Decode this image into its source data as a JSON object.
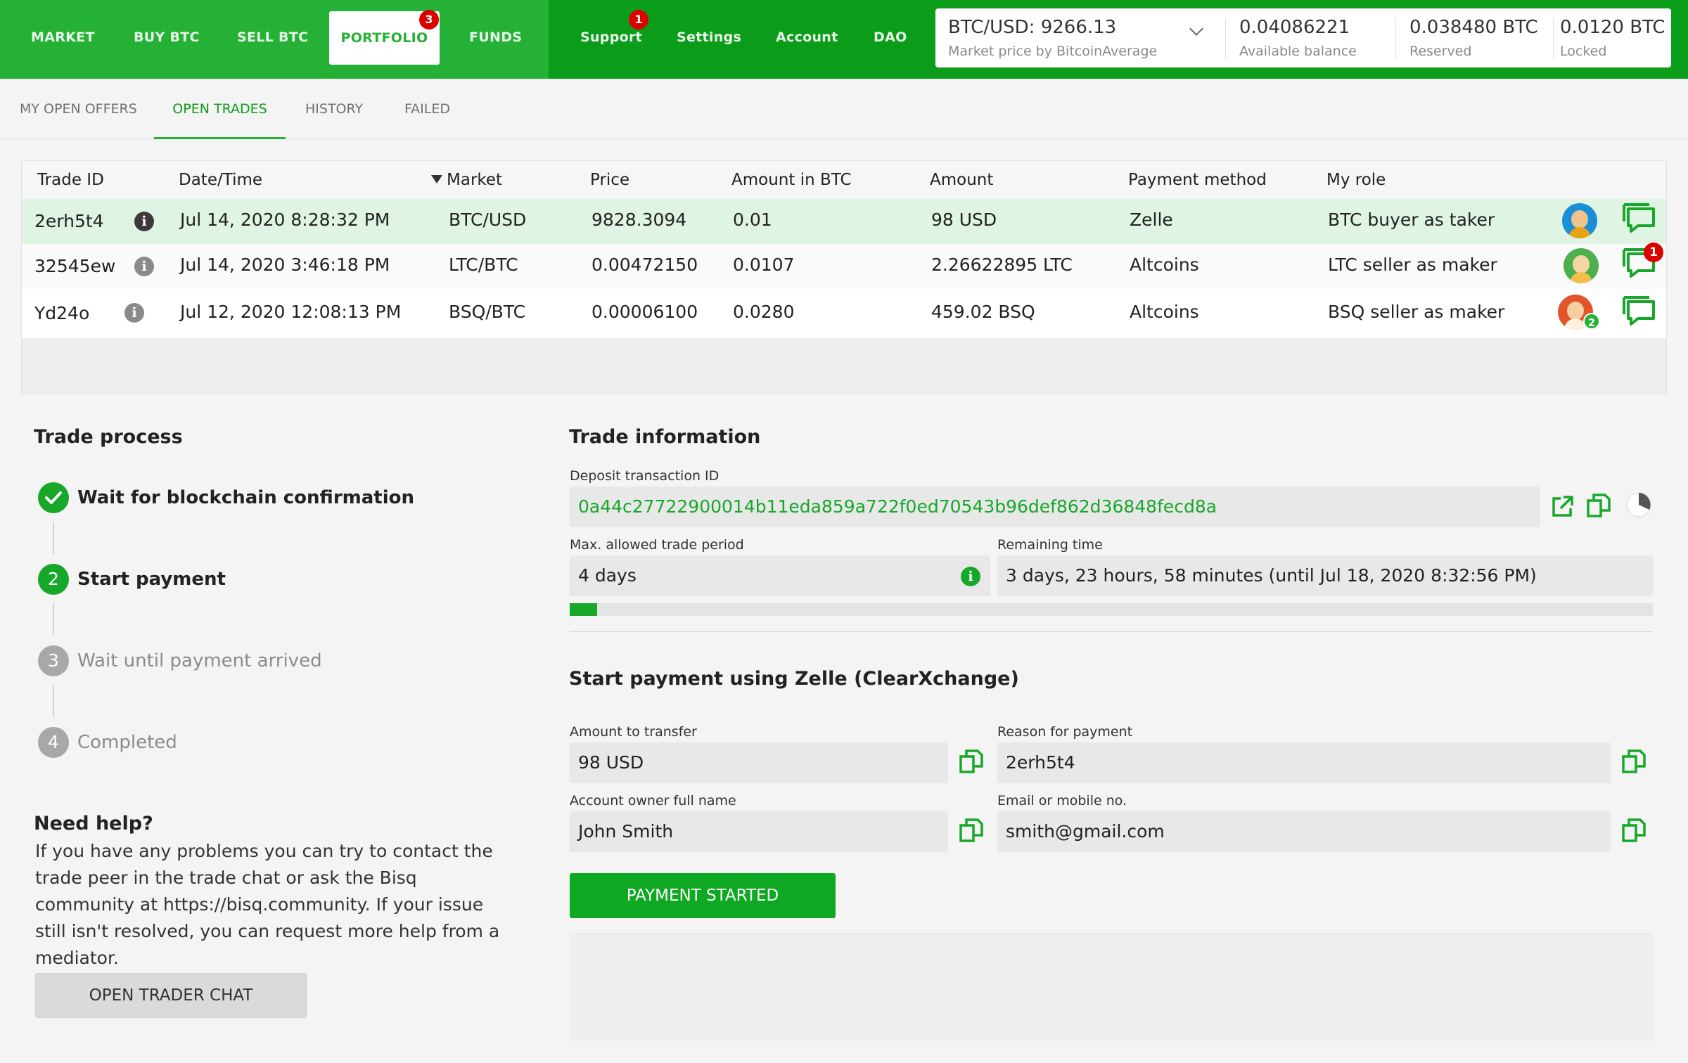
{
  "nav": {
    "market": "MARKET",
    "buy_btc": "BUY BTC",
    "sell_btc": "SELL BTC",
    "portfolio": "PORTFOLIO",
    "portfolio_badge": "3",
    "funds": "FUNDS",
    "support": "Support",
    "support_badge": "1",
    "settings": "Settings",
    "account": "Account",
    "dao": "DAO"
  },
  "balances": {
    "price": "BTC/USD: 9266.13",
    "price_sub": "Market price by BitcoinAverage",
    "available": "0.04086221",
    "available_label": "Available balance",
    "reserved": "0.038480 BTC",
    "reserved_label": "Reserved",
    "locked": "0.0120 BTC",
    "locked_label": "Locked"
  },
  "subtabs": {
    "open_offers": "MY OPEN OFFERS",
    "open_trades": "OPEN TRADES",
    "history": "HISTORY",
    "failed": "FAILED"
  },
  "table": {
    "headers": {
      "trade_id": "Trade ID",
      "datetime": "Date/Time",
      "market": "Market",
      "price": "Price",
      "amount_btc": "Amount in BTC",
      "amount": "Amount",
      "payment_method": "Payment method",
      "my_role": "My role"
    },
    "rows": [
      {
        "id": "2erh5t4",
        "date": "Jul 14, 2020 8:28:32 PM",
        "market": "BTC/USD",
        "price": "9828.3094",
        "amount_btc": "0.01",
        "amount": "98 USD",
        "method": "Zelle",
        "role": "BTC buyer as taker",
        "chat_badge": "",
        "avatar_badge": ""
      },
      {
        "id": "32545ew",
        "date": "Jul 14, 2020 3:46:18 PM",
        "market": "LTC/BTC",
        "price": "0.00472150",
        "amount_btc": "0.0107",
        "amount": "2.26622895 LTC",
        "method": "Altcoins",
        "role": "LTC seller as maker",
        "chat_badge": "1",
        "avatar_badge": ""
      },
      {
        "id": "Yd24o",
        "date": "Jul 12, 2020 12:08:13 PM",
        "market": "BSQ/BTC",
        "price": "0.00006100",
        "amount_btc": "0.0280",
        "amount": "459.02 BSQ",
        "method": "Altcoins",
        "role": "BSQ seller as maker",
        "chat_badge": "",
        "avatar_badge": "2"
      }
    ]
  },
  "process": {
    "title": "Trade process",
    "steps": [
      {
        "num": "",
        "label": "Wait for blockchain confirmation",
        "state": "done"
      },
      {
        "num": "2",
        "label": "Start payment",
        "state": "active"
      },
      {
        "num": "3",
        "label": "Wait until payment arrived",
        "state": "pending"
      },
      {
        "num": "4",
        "label": "Completed",
        "state": "pending"
      }
    ],
    "help_title": "Need help?",
    "help_text": "If you have any problems you can try to contact the trade peer in the trade chat or ask the Bisq community at https://bisq.community. If your issue still isn't resolved, you can request more help from a mediator.",
    "chat_button": "OPEN TRADER CHAT"
  },
  "info": {
    "title": "Trade information",
    "deposit_label": "Deposit transaction ID",
    "deposit_id": "0a44c27722900014b11eda859a722f0ed70543b96def862d36848fecd8a",
    "max_period_label": "Max. allowed trade period",
    "max_period": "4 days",
    "remaining_label": "Remaining time",
    "remaining": "3 days, 23 hours, 58 minutes (until Jul 18, 2020 8:32:56 PM)",
    "progress_fraction": 0.025
  },
  "payment": {
    "title": "Start payment using Zelle (ClearXchange)",
    "amount_label": "Amount to transfer",
    "amount": "98 USD",
    "reason_label": "Reason for payment",
    "reason": "2erh5t4",
    "owner_label": "Account owner full name",
    "owner": "John Smith",
    "email_label": "Email or mobile no.",
    "email": "smith@gmail.com",
    "button": "PAYMENT STARTED"
  },
  "colors": {
    "brand_green": "#25b135",
    "dark_green": "#0b9c1a",
    "badge_red": "#dd0000"
  }
}
